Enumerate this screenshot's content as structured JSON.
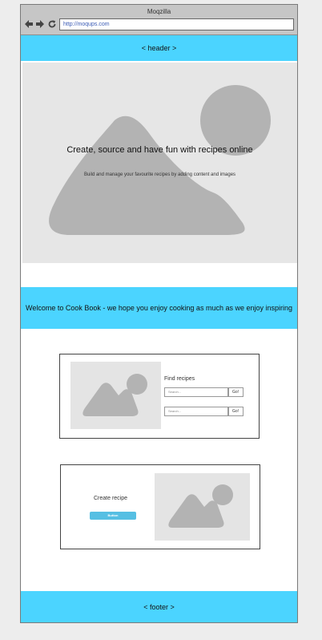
{
  "browser": {
    "title": "Moqzilla",
    "url": "http://moqups.com",
    "icons": [
      "back-arrow-icon",
      "forward-arrow-icon",
      "reload-icon"
    ]
  },
  "header": {
    "label": "< header >"
  },
  "hero": {
    "title": "Create, source and have fun with recipes online",
    "subtitle": "Build and manage your favourite recipes by adding content and images"
  },
  "welcome": {
    "text": "Welcome to Cook Book - we hope you enjoy cooking as much as we enjoy inspiring"
  },
  "find_card": {
    "label": "Find recipes",
    "search_placeholder": "Search...",
    "go_label": "Go!"
  },
  "create_card": {
    "label": "Create recipe",
    "button_label": "Button"
  },
  "footer": {
    "label": "< footer >"
  },
  "colors": {
    "band": "#4bd4ff",
    "button": "#56bfe3",
    "placeholder": "#e6e6e6",
    "placeholder_shape": "#b3b3b3"
  }
}
